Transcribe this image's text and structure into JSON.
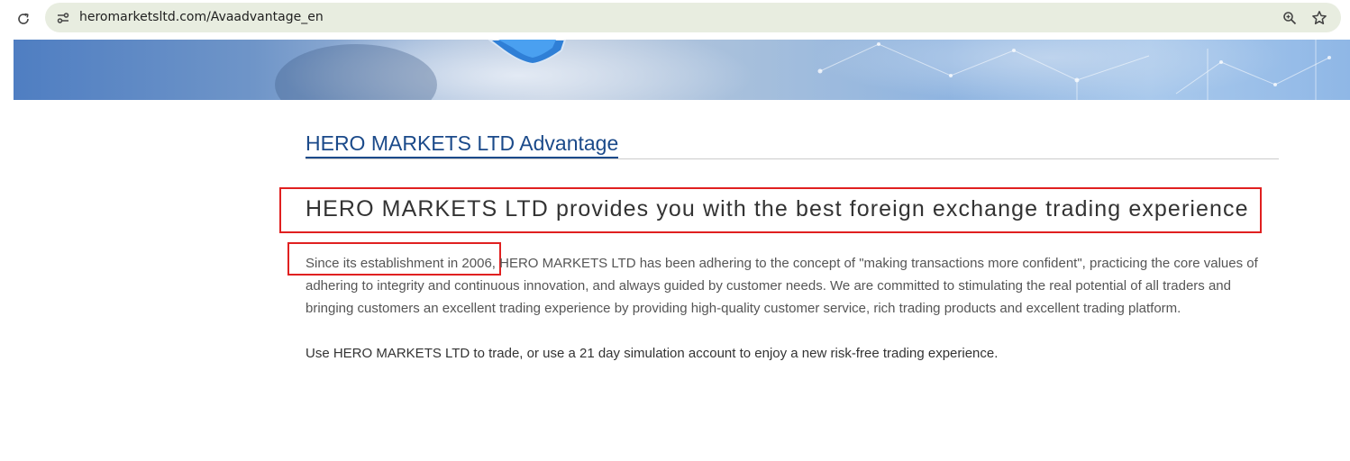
{
  "browser": {
    "url": "heromarketsltd.com/Avaadvantage_en"
  },
  "content": {
    "section_title": "HERO MARKETS LTD Advantage",
    "headline": "HERO MARKETS LTD provides you with the best foreign exchange trading experience",
    "paragraph_highlight": "Since its establishment in 2006",
    "paragraph_rest": ", HERO MARKETS LTD has been adhering to the concept of \"making transactions more confident\", practicing the core values of adhering to integrity and continuous innovation, and always guided by customer needs. We are committed to stimulating the real potential of all traders and bringing customers an excellent trading experience by providing high-quality customer service, rich trading products and excellent trading platform.",
    "paragraph_2": "Use HERO MARKETS LTD to trade, or use a 21 day simulation account to enjoy a new risk-free trading experience."
  },
  "colors": {
    "title_blue": "#1b4a8a",
    "annotation_red": "#e02020",
    "omnibox_bg": "#e8ede0"
  },
  "icons": {
    "reload": "reload-icon",
    "site_info": "site-settings-icon",
    "zoom": "zoom-icon",
    "bookmark": "star-icon"
  }
}
